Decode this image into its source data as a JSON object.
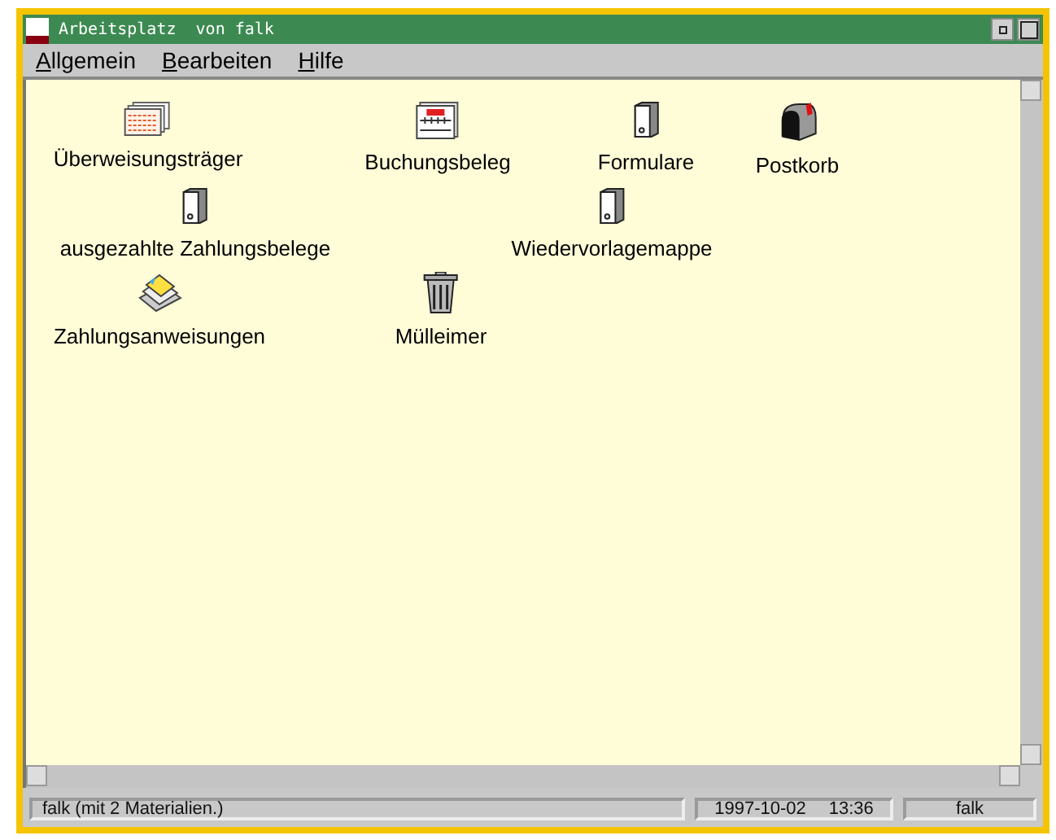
{
  "window": {
    "title": "Arbeitsplatz  von falk"
  },
  "menu": [
    "Allgemein",
    "Bearbeiten",
    "Hilfe"
  ],
  "icons": [
    {
      "label": "Überweisungsträger",
      "kind": "form"
    },
    {
      "label": "Buchungsbeleg",
      "kind": "ledger"
    },
    {
      "label": "Formulare",
      "kind": "binder"
    },
    {
      "label": "Postkorb",
      "kind": "mailbox"
    },
    {
      "label": "ausgezahlte Zahlungsbelege",
      "kind": "binder"
    },
    {
      "label": "Wiedervorlagemappe",
      "kind": "binder"
    },
    {
      "label": "Zahlungsanweisungen",
      "kind": "payments"
    },
    {
      "label": "Mülleimer",
      "kind": "trash"
    }
  ],
  "status_bar": {
    "message": "falk (mit 2 Materialien.)",
    "date": "1997-10-02",
    "time": "13:36",
    "user": "falk"
  }
}
